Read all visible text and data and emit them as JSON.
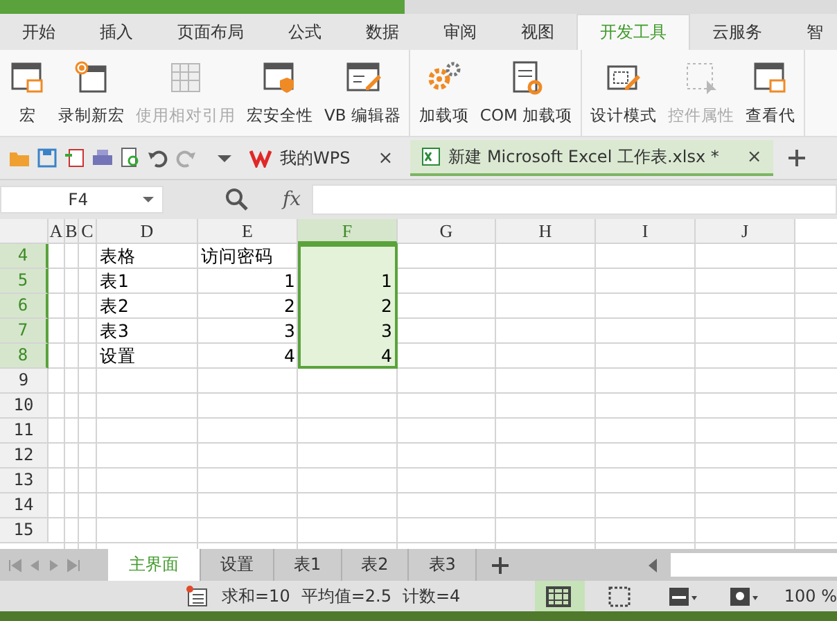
{
  "ribbon_tabs": [
    {
      "label": "开始",
      "selected": false
    },
    {
      "label": "插入",
      "selected": false
    },
    {
      "label": "页面布局",
      "selected": false
    },
    {
      "label": "公式",
      "selected": false
    },
    {
      "label": "数据",
      "selected": false
    },
    {
      "label": "审阅",
      "selected": false
    },
    {
      "label": "视图",
      "selected": false
    },
    {
      "label": "开发工具",
      "selected": true
    },
    {
      "label": "云服务",
      "selected": false
    },
    {
      "label": "智",
      "selected": false
    }
  ],
  "ribbon_groups": [
    [
      {
        "label": "宏",
        "kind": "window",
        "disabled": false
      },
      {
        "label": "录制新宏",
        "kind": "record",
        "disabled": false
      },
      {
        "label": "使用相对引用",
        "kind": "grid",
        "disabled": true
      },
      {
        "label": "宏安全性",
        "kind": "shield",
        "disabled": false
      },
      {
        "label": "VB 编辑器",
        "kind": "edit",
        "disabled": false
      }
    ],
    [
      {
        "label": "加载项",
        "kind": "gears",
        "disabled": false
      },
      {
        "label": "COM 加载项",
        "kind": "doc",
        "disabled": false
      }
    ],
    [
      {
        "label": "设计模式",
        "kind": "design",
        "disabled": false
      },
      {
        "label": "控件属性",
        "kind": "select",
        "disabled": true
      },
      {
        "label": "查看代",
        "kind": "window",
        "disabled": false
      }
    ]
  ],
  "doc_tabs": [
    {
      "label": "我的WPS",
      "close": "×",
      "kind": "wps",
      "selected": false
    },
    {
      "label": "新建 Microsoft Excel 工作表.xlsx *",
      "close": "×",
      "kind": "excel",
      "selected": true
    }
  ],
  "formula_bar": {
    "name_box": "F4",
    "fx": "fx"
  },
  "columns": [
    {
      "label": "A",
      "selected": false
    },
    {
      "label": "B",
      "selected": false
    },
    {
      "label": "C",
      "selected": false
    },
    {
      "label": "D",
      "selected": false
    },
    {
      "label": "E",
      "selected": false
    },
    {
      "label": "F",
      "selected": true
    },
    {
      "label": "G",
      "selected": false
    },
    {
      "label": "H",
      "selected": false
    },
    {
      "label": "I",
      "selected": false
    },
    {
      "label": "J",
      "selected": false
    }
  ],
  "rows": [
    {
      "header": "4",
      "selected": true,
      "col_d": {
        "text": "表格",
        "kind": "text"
      },
      "col_e": {
        "text": "访问密码",
        "kind": "text"
      }
    },
    {
      "header": "5",
      "selected": true,
      "col_d": {
        "text": "表1",
        "kind": "text"
      },
      "col_e": {
        "text": "1",
        "kind": "number"
      },
      "col_f": {
        "text": "1",
        "kind": "number"
      }
    },
    {
      "header": "6",
      "selected": true,
      "col_d": {
        "text": "表2",
        "kind": "text"
      },
      "col_e": {
        "text": "2",
        "kind": "number"
      },
      "col_f": {
        "text": "2",
        "kind": "number"
      }
    },
    {
      "header": "7",
      "selected": true,
      "col_d": {
        "text": "表3",
        "kind": "text"
      },
      "col_e": {
        "text": "3",
        "kind": "number"
      },
      "col_f": {
        "text": "3",
        "kind": "number"
      }
    },
    {
      "header": "8",
      "selected": true,
      "col_d": {
        "text": "设置",
        "kind": "text"
      },
      "col_e": {
        "text": "4",
        "kind": "number"
      },
      "col_f": {
        "text": "4",
        "kind": "number"
      }
    },
    {
      "header": "9",
      "selected": false
    },
    {
      "header": "10",
      "selected": false
    },
    {
      "header": "11",
      "selected": false
    },
    {
      "header": "12",
      "selected": false
    },
    {
      "header": "13",
      "selected": false
    },
    {
      "header": "14",
      "selected": false
    },
    {
      "header": "15",
      "selected": false
    }
  ],
  "sheet_tabs": [
    {
      "label": "主界面",
      "selected": true
    },
    {
      "label": "设置",
      "selected": false
    },
    {
      "label": "表1",
      "selected": false
    },
    {
      "label": "表2",
      "selected": false
    },
    {
      "label": "表3",
      "selected": false
    }
  ],
  "status_bar": {
    "stats": [
      "求和=10",
      "平均值=2.5",
      "计数=4"
    ],
    "views": [
      {
        "kind": "normal",
        "selected": true
      },
      {
        "kind": "page",
        "selected": false
      },
      {
        "kind": "layout",
        "selected": false
      },
      {
        "kind": "eye",
        "selected": false
      }
    ],
    "zoom": "100 %"
  }
}
